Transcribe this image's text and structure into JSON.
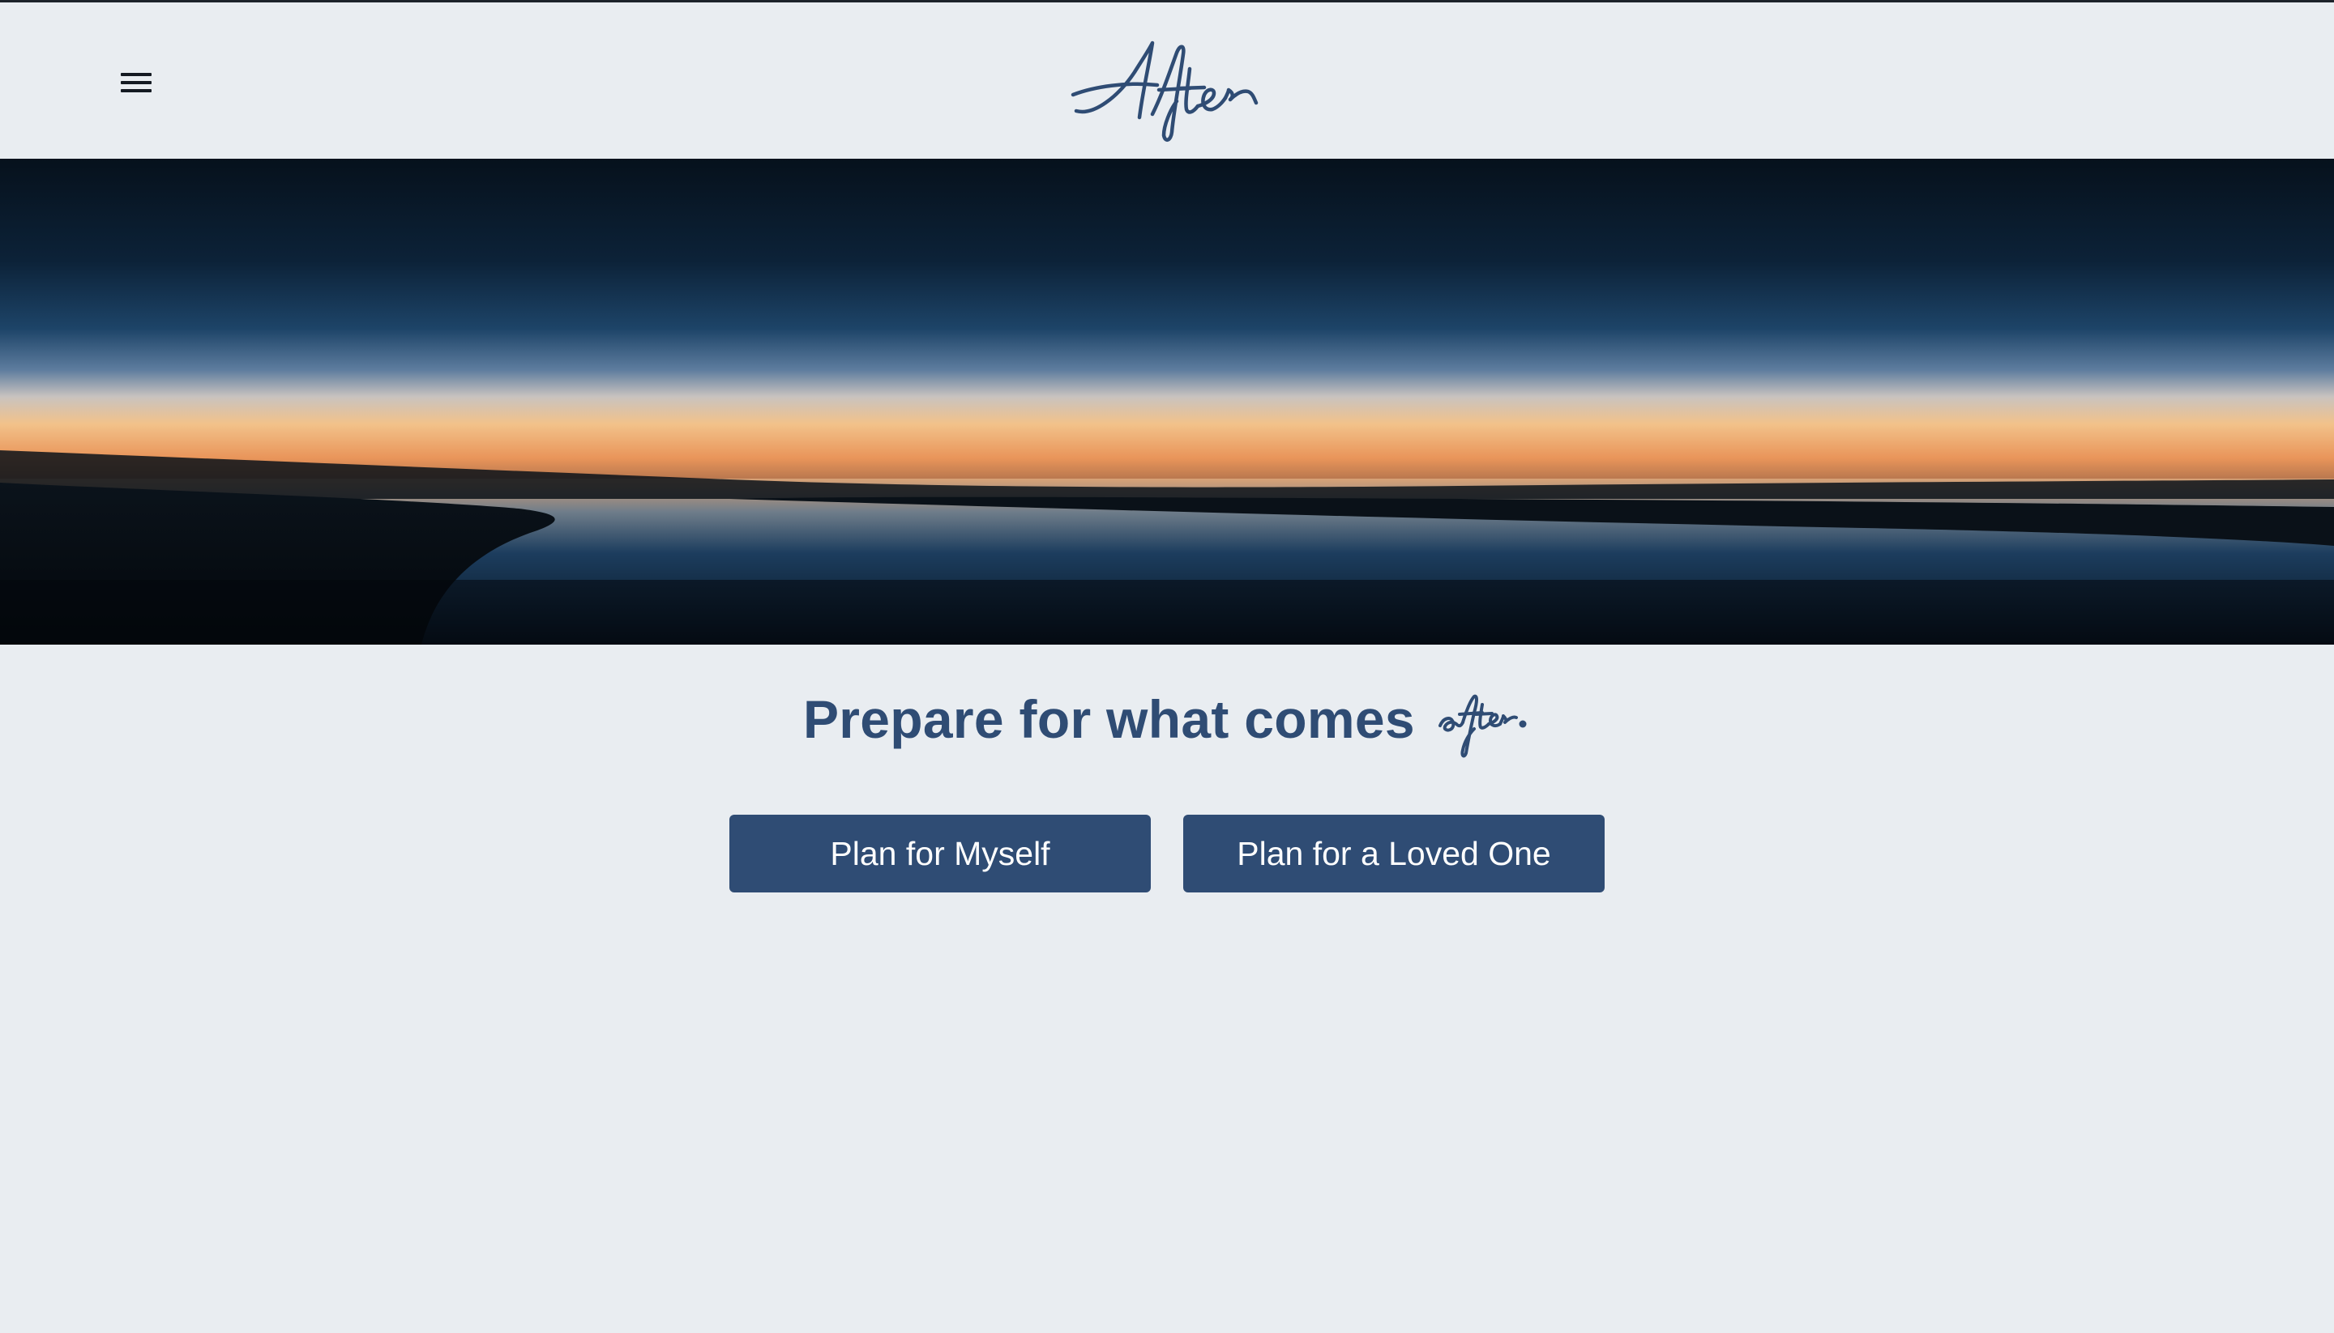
{
  "header": {
    "logo_text": "After",
    "menu_icon": "hamburger-menu-icon"
  },
  "hero": {
    "image": "dusk-beach-horizon-photo"
  },
  "main": {
    "headline": "Prepare for what comes",
    "headline_script": "after."
  },
  "actions": {
    "plan_myself": "Plan for Myself",
    "plan_loved_one": "Plan for a Loved One"
  },
  "colors": {
    "background": "#e9edf1",
    "brand_navy": "#2f4c74",
    "button_text": "#ffffff"
  }
}
